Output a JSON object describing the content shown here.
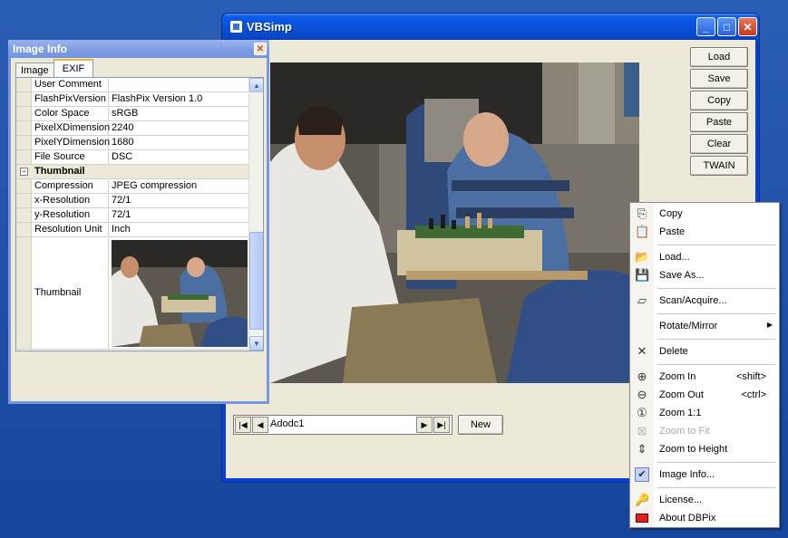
{
  "main_window": {
    "title": "VBSimp",
    "buttons": [
      "Load",
      "Save",
      "Copy",
      "Paste",
      "Clear",
      "TWAIN"
    ],
    "data_nav_caption": "Adodc1",
    "new_label": "New"
  },
  "info_window": {
    "title": "Image Info",
    "tabs": [
      "Image",
      "EXIF"
    ],
    "active_tab": "EXIF",
    "rows": [
      {
        "key": "User Comment",
        "value": ""
      },
      {
        "key": "FlashPixVersion",
        "value": "FlashPix Version 1.0"
      },
      {
        "key": "Color Space",
        "value": "sRGB"
      },
      {
        "key": "PixelXDimension",
        "value": "2240"
      },
      {
        "key": "PixelYDimension",
        "value": "1680"
      },
      {
        "key": "File Source",
        "value": "DSC"
      }
    ],
    "section": {
      "toggle": "−",
      "label": "Thumbnail"
    },
    "thumb_rows": [
      {
        "key": "Compression",
        "value": "JPEG compression"
      },
      {
        "key": "x-Resolution",
        "value": "72/1"
      },
      {
        "key": "y-Resolution",
        "value": "72/1"
      },
      {
        "key": "Resolution Unit",
        "value": "Inch"
      }
    ],
    "thumbnail_label": "Thumbnail"
  },
  "context_menu": {
    "items": {
      "copy": "Copy",
      "paste": "Paste",
      "load": "Load...",
      "save_as": "Save As...",
      "scan": "Scan/Acquire...",
      "rotate": "Rotate/Mirror",
      "delete": "Delete",
      "zoom_in": "Zoom In",
      "zoom_in_shortcut": "<shift>",
      "zoom_out": "Zoom Out",
      "zoom_out_shortcut": "<ctrl>",
      "zoom_1_1": "Zoom 1:1",
      "zoom_fit": "Zoom to Fit",
      "zoom_height": "Zoom to Height",
      "image_info": "Image Info...",
      "license": "License...",
      "about": "About DBPix"
    }
  },
  "colors": {
    "desktop": "#1f4ea3",
    "titlebar": "#0a52da",
    "window_face": "#ece9d8"
  }
}
